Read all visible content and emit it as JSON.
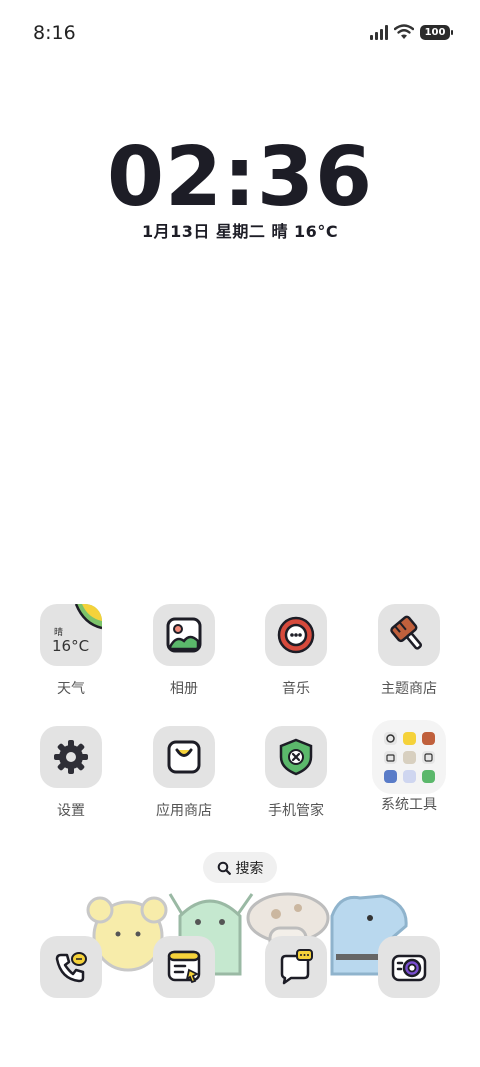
{
  "status_bar": {
    "time": "8:16",
    "battery": "100",
    "icons": [
      "signal-icon",
      "wifi-icon",
      "battery-icon"
    ]
  },
  "clock_widget": {
    "time": "02:36",
    "date_line": "1月13日  星期二  晴  16°C"
  },
  "apps_row1": [
    {
      "label": "天气",
      "icon": "weather-icon",
      "condition": "晴",
      "temp": "16°C"
    },
    {
      "label": "相册",
      "icon": "gallery-icon"
    },
    {
      "label": "音乐",
      "icon": "music-icon"
    },
    {
      "label": "主题商店",
      "icon": "theme-store-icon"
    }
  ],
  "apps_row2": [
    {
      "label": "设置",
      "icon": "settings-gear-icon"
    },
    {
      "label": "应用商店",
      "icon": "app-store-bag-icon"
    },
    {
      "label": "手机管家",
      "icon": "security-shield-icon"
    },
    {
      "label": "系统工具",
      "icon": "folder-icon"
    }
  ],
  "search": {
    "label": "搜索",
    "icon": "search-icon"
  },
  "dock": [
    {
      "icon": "phone-icon"
    },
    {
      "icon": "messages-icon"
    },
    {
      "icon": "chat-bubble-icon"
    },
    {
      "icon": "camera-icon"
    }
  ],
  "colors": {
    "icon_bg": "#e3e3e3",
    "red": "#d64a3c",
    "yellow": "#f5d23a",
    "green": "#5bb86b",
    "dark": "#1d1d26"
  }
}
